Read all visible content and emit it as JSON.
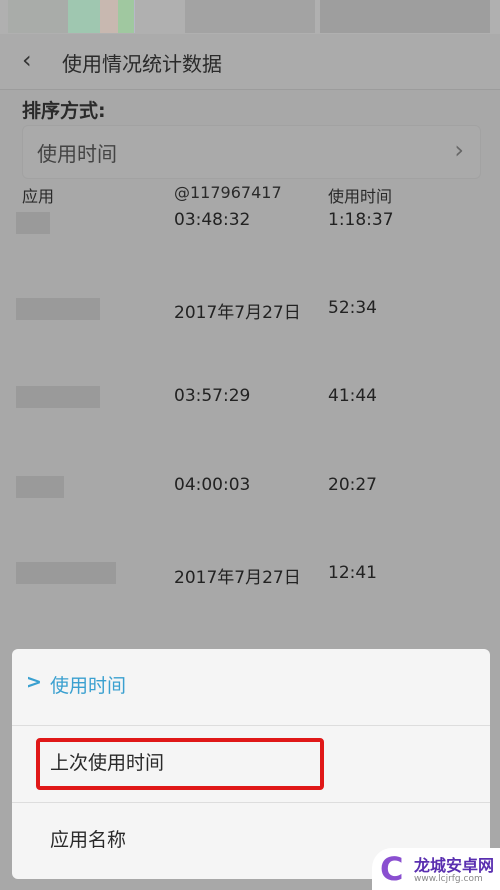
{
  "header": {
    "title": "使用情况统计数据",
    "back_icon": "chevron-left-icon"
  },
  "sort": {
    "label": "排序方式:",
    "value": "使用时间"
  },
  "table": {
    "headers": [
      "应用",
      "@117967417",
      "使用时间"
    ],
    "rows": [
      {
        "col2": "03:48:32",
        "col3": "1:18:37"
      },
      {
        "col2": "2017年7月27日",
        "col3": "52:34"
      },
      {
        "col2": "03:57:29",
        "col3": "41:44"
      },
      {
        "col2": "04:00:03",
        "col3": "20:27"
      },
      {
        "col2": "2017年7月27日",
        "col3": "12:41"
      }
    ]
  },
  "sheet": {
    "options": [
      {
        "label": "使用时间",
        "selected": true
      },
      {
        "label": "上次使用时间",
        "highlighted": true
      },
      {
        "label": "应用名称"
      }
    ]
  },
  "colors": {
    "accent": "#3aa0d0",
    "highlight": "#e01818"
  },
  "watermark": {
    "name": "龙城安卓网",
    "url": "www.lcjrfg.com"
  }
}
